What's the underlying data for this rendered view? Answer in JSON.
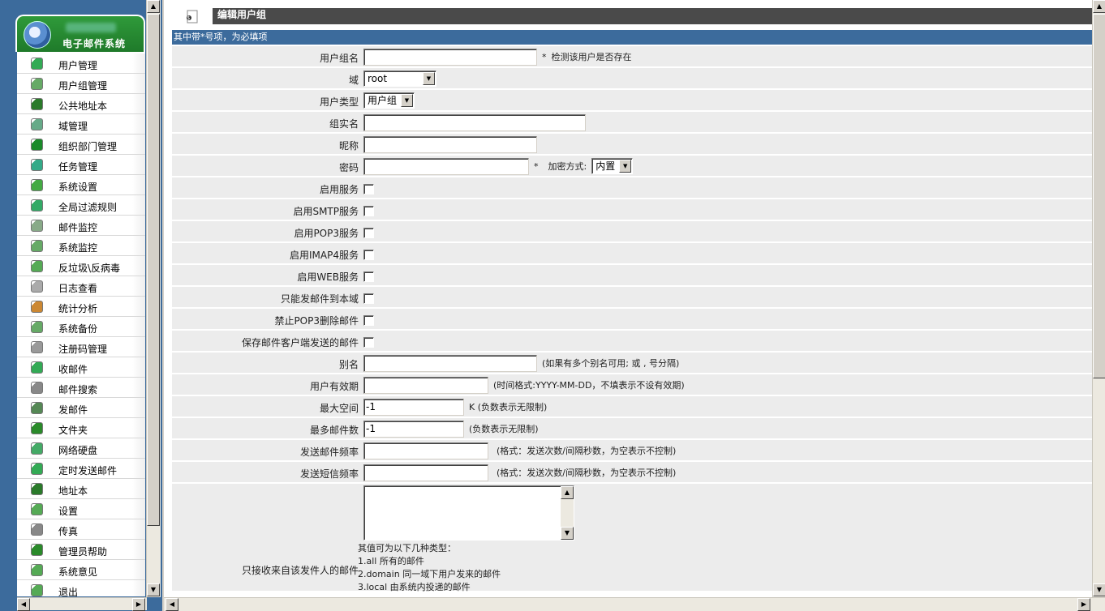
{
  "sidebar": {
    "brand_title": "电子邮件系统",
    "items": [
      {
        "label": "用户管理",
        "icon": "user-icon",
        "color": "#3a5"
      },
      {
        "label": "用户组管理",
        "icon": "user-group-icon",
        "color": "#6a6"
      },
      {
        "label": "公共地址本",
        "icon": "address-book-icon",
        "color": "#2a7a2a"
      },
      {
        "label": "域管理",
        "icon": "domain-icon",
        "color": "#6a8"
      },
      {
        "label": "组织部门管理",
        "icon": "org-chart-icon",
        "color": "#1a8a2a"
      },
      {
        "label": "任务管理",
        "icon": "task-calendar-icon",
        "color": "#3a8"
      },
      {
        "label": "系统设置",
        "icon": "gear-icon",
        "color": "#4a4"
      },
      {
        "label": "全局过滤规则",
        "icon": "filter-icon",
        "color": "#3a6"
      },
      {
        "label": "邮件监控",
        "icon": "mail-monitor-icon",
        "color": "#8a8"
      },
      {
        "label": "系统监控",
        "icon": "system-monitor-icon",
        "color": "#6a6"
      },
      {
        "label": "反垃圾\\反病毒",
        "icon": "antispam-icon",
        "color": "#5a5"
      },
      {
        "label": "日志查看",
        "icon": "log-document-icon",
        "color": "#aaa"
      },
      {
        "label": "统计分析",
        "icon": "statistics-chart-icon",
        "color": "#c83"
      },
      {
        "label": "系统备份",
        "icon": "backup-icon",
        "color": "#6a6"
      },
      {
        "label": "注册码管理",
        "icon": "lock-icon",
        "color": "#999"
      },
      {
        "label": "收邮件",
        "icon": "inbox-mail-icon",
        "color": "#3a5"
      },
      {
        "label": "邮件搜索",
        "icon": "search-icon",
        "color": "#888"
      },
      {
        "label": "发邮件",
        "icon": "pen-icon",
        "color": "#585"
      },
      {
        "label": "文件夹",
        "icon": "folder-icon",
        "color": "#2a8a2a"
      },
      {
        "label": "网络硬盘",
        "icon": "network-disk-icon",
        "color": "#4a6"
      },
      {
        "label": "定时发送邮件",
        "icon": "scheduled-mail-icon",
        "color": "#3a5"
      },
      {
        "label": "地址本",
        "icon": "contacts-book-icon",
        "color": "#2a7a2a"
      },
      {
        "label": "设置",
        "icon": "settings-icon",
        "color": "#5a5"
      },
      {
        "label": "传真",
        "icon": "fax-icon",
        "color": "#888"
      },
      {
        "label": "管理员帮助",
        "icon": "help-icon",
        "color": "#2a8a2a"
      },
      {
        "label": "系统意见",
        "icon": "feedback-icon",
        "color": "#5a5"
      },
      {
        "label": "退出",
        "icon": "exit-icon",
        "color": "#5a5"
      }
    ]
  },
  "header": {
    "title": "编辑用户组",
    "required_note": "其中带*号项，为必填项"
  },
  "form": {
    "group_name": {
      "label": "用户组名",
      "value": "",
      "star": "*",
      "hint": "检测该用户是否存在"
    },
    "domain": {
      "label": "域",
      "value": "root"
    },
    "user_type": {
      "label": "用户类型",
      "value": "用户组"
    },
    "real_name": {
      "label": "组实名",
      "value": ""
    },
    "nickname": {
      "label": "昵称",
      "value": ""
    },
    "password": {
      "label": "密码",
      "value": "",
      "star": "*",
      "enc_label": "加密方式:",
      "enc_value": "内置"
    },
    "enable_service": {
      "label": "启用服务"
    },
    "enable_smtp": {
      "label": "启用SMTP服务"
    },
    "enable_pop3": {
      "label": "启用POP3服务"
    },
    "enable_imap4": {
      "label": "启用IMAP4服务"
    },
    "enable_web": {
      "label": "启用WEB服务"
    },
    "local_only": {
      "label": "只能发邮件到本域"
    },
    "no_pop3_delete": {
      "label": "禁止POP3删除邮件"
    },
    "save_sent": {
      "label": "保存邮件客户端发送的邮件"
    },
    "alias": {
      "label": "别名",
      "value": "",
      "hint": "(如果有多个别名可用; 或 , 号分隔)"
    },
    "expiry": {
      "label": "用户有效期",
      "value": "",
      "hint": "(时间格式:YYYY-MM-DD，不填表示不设有效期)"
    },
    "max_space": {
      "label": "最大空间",
      "value": "-1",
      "hint": "K (负数表示无限制)"
    },
    "max_mails": {
      "label": "最多邮件数",
      "value": "-1",
      "hint": "(负数表示无限制)"
    },
    "mail_rate": {
      "label": "发送邮件频率",
      "value": "",
      "hint": "(格式：发送次数/间隔秒数，为空表示不控制)"
    },
    "sms_rate": {
      "label": "发送短信频率",
      "value": "",
      "hint": "(格式：发送次数/间隔秒数，为空表示不控制)"
    },
    "accept_from": {
      "label": "只接收来自该发件人的邮件",
      "value": "",
      "desc_title": "其值可为以下几种类型：",
      "desc_1": "1.all 所有的邮件",
      "desc_2": "2.domain 同一域下用户发来的邮件",
      "desc_3": "3.local 由系统内投递的邮件"
    }
  }
}
